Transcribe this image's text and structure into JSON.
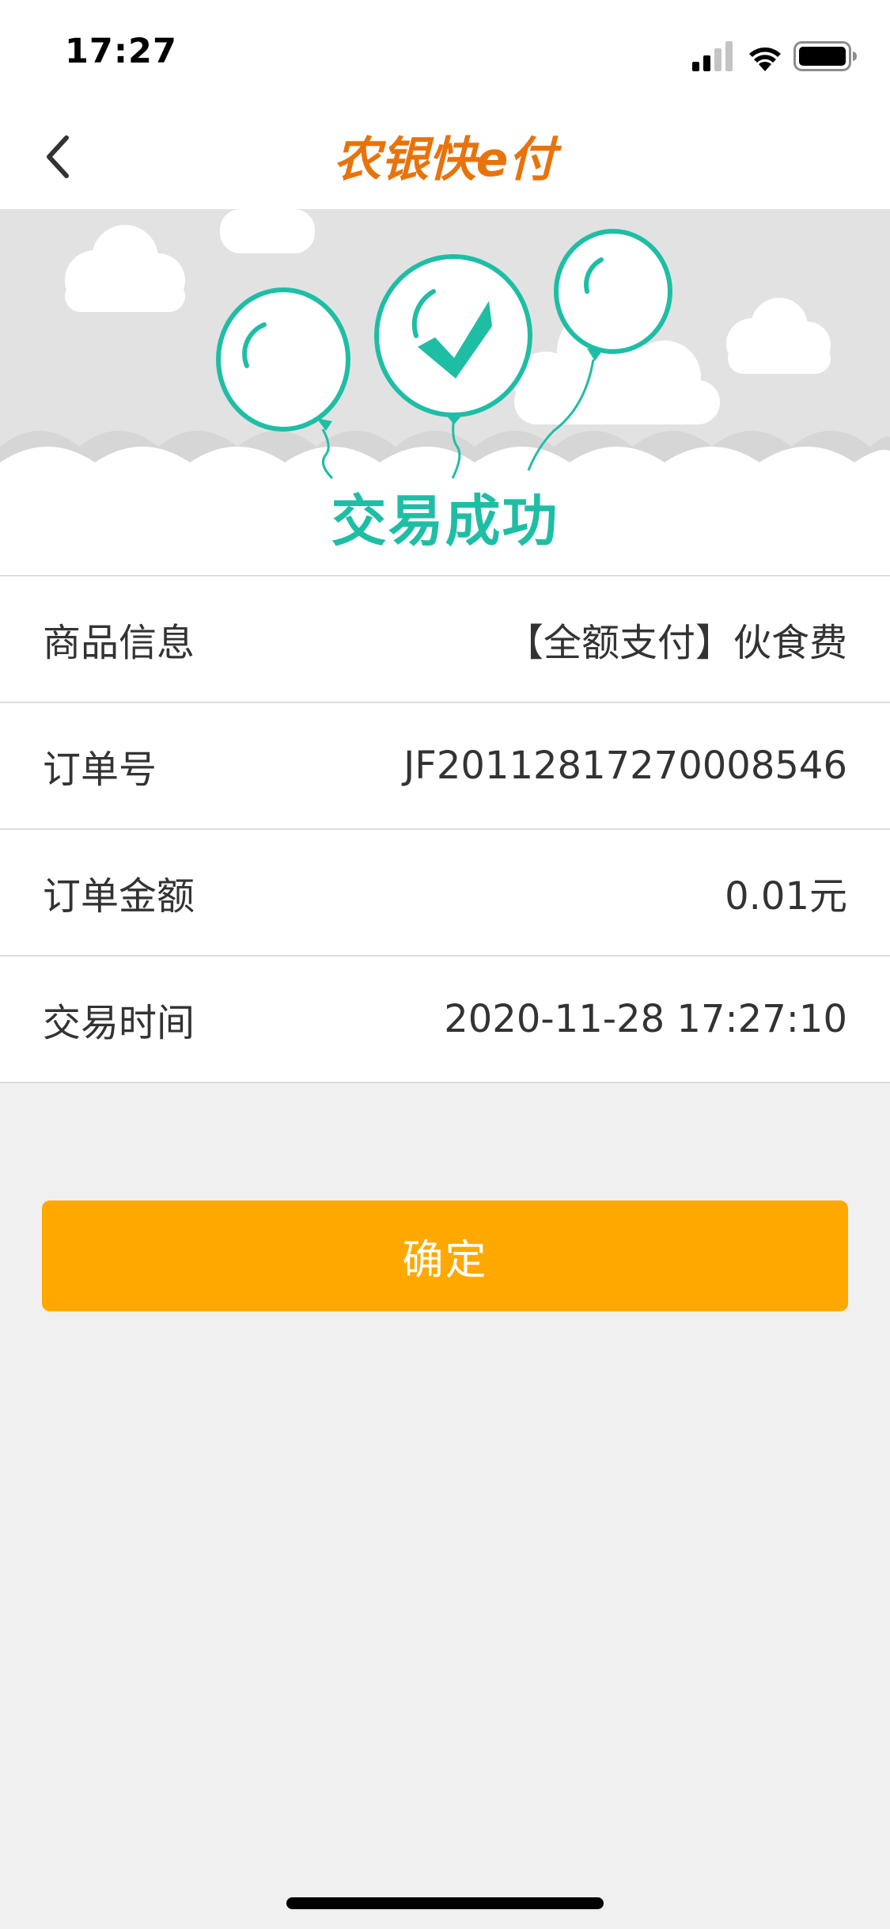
{
  "status_bar": {
    "time": "17:27"
  },
  "nav": {
    "brand_name": "农银快e付"
  },
  "result": {
    "title": "交易成功"
  },
  "info_rows": [
    {
      "label": "商品信息",
      "value": "【全额支付】伙食费"
    },
    {
      "label": "订单号",
      "value": "JF20112817270008546"
    },
    {
      "label": "订单金额",
      "value": "0.01元"
    },
    {
      "label": "交易时间",
      "value": "2020-11-28 17:27:10"
    }
  ],
  "actions": {
    "confirm_label": "确定"
  },
  "icons": {
    "back": "chevron-left-icon",
    "check": "checkmark-icon",
    "signal": "cellular-signal-icon",
    "wifi": "wifi-icon",
    "battery": "battery-icon"
  },
  "colors": {
    "accent": "#ffa800",
    "success": "#1ebea5",
    "brand": "#e8730c"
  }
}
